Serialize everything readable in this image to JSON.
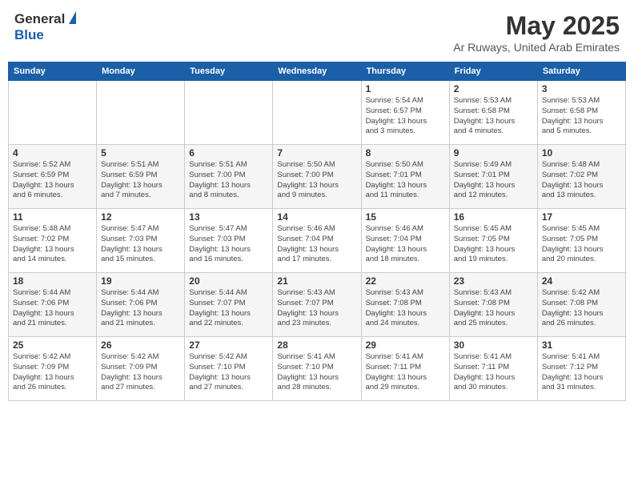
{
  "header": {
    "logo_general": "General",
    "logo_blue": "Blue",
    "title": "May 2025",
    "subtitle": "Ar Ruways, United Arab Emirates"
  },
  "weekdays": [
    "Sunday",
    "Monday",
    "Tuesday",
    "Wednesday",
    "Thursday",
    "Friday",
    "Saturday"
  ],
  "weeks": [
    [
      {
        "day": "",
        "info": ""
      },
      {
        "day": "",
        "info": ""
      },
      {
        "day": "",
        "info": ""
      },
      {
        "day": "",
        "info": ""
      },
      {
        "day": "1",
        "info": "Sunrise: 5:54 AM\nSunset: 6:57 PM\nDaylight: 13 hours\nand 3 minutes."
      },
      {
        "day": "2",
        "info": "Sunrise: 5:53 AM\nSunset: 6:58 PM\nDaylight: 13 hours\nand 4 minutes."
      },
      {
        "day": "3",
        "info": "Sunrise: 5:53 AM\nSunset: 6:58 PM\nDaylight: 13 hours\nand 5 minutes."
      }
    ],
    [
      {
        "day": "4",
        "info": "Sunrise: 5:52 AM\nSunset: 6:59 PM\nDaylight: 13 hours\nand 6 minutes."
      },
      {
        "day": "5",
        "info": "Sunrise: 5:51 AM\nSunset: 6:59 PM\nDaylight: 13 hours\nand 7 minutes."
      },
      {
        "day": "6",
        "info": "Sunrise: 5:51 AM\nSunset: 7:00 PM\nDaylight: 13 hours\nand 8 minutes."
      },
      {
        "day": "7",
        "info": "Sunrise: 5:50 AM\nSunset: 7:00 PM\nDaylight: 13 hours\nand 9 minutes."
      },
      {
        "day": "8",
        "info": "Sunrise: 5:50 AM\nSunset: 7:01 PM\nDaylight: 13 hours\nand 11 minutes."
      },
      {
        "day": "9",
        "info": "Sunrise: 5:49 AM\nSunset: 7:01 PM\nDaylight: 13 hours\nand 12 minutes."
      },
      {
        "day": "10",
        "info": "Sunrise: 5:48 AM\nSunset: 7:02 PM\nDaylight: 13 hours\nand 13 minutes."
      }
    ],
    [
      {
        "day": "11",
        "info": "Sunrise: 5:48 AM\nSunset: 7:02 PM\nDaylight: 13 hours\nand 14 minutes."
      },
      {
        "day": "12",
        "info": "Sunrise: 5:47 AM\nSunset: 7:03 PM\nDaylight: 13 hours\nand 15 minutes."
      },
      {
        "day": "13",
        "info": "Sunrise: 5:47 AM\nSunset: 7:03 PM\nDaylight: 13 hours\nand 16 minutes."
      },
      {
        "day": "14",
        "info": "Sunrise: 5:46 AM\nSunset: 7:04 PM\nDaylight: 13 hours\nand 17 minutes."
      },
      {
        "day": "15",
        "info": "Sunrise: 5:46 AM\nSunset: 7:04 PM\nDaylight: 13 hours\nand 18 minutes."
      },
      {
        "day": "16",
        "info": "Sunrise: 5:45 AM\nSunset: 7:05 PM\nDaylight: 13 hours\nand 19 minutes."
      },
      {
        "day": "17",
        "info": "Sunrise: 5:45 AM\nSunset: 7:05 PM\nDaylight: 13 hours\nand 20 minutes."
      }
    ],
    [
      {
        "day": "18",
        "info": "Sunrise: 5:44 AM\nSunset: 7:06 PM\nDaylight: 13 hours\nand 21 minutes."
      },
      {
        "day": "19",
        "info": "Sunrise: 5:44 AM\nSunset: 7:06 PM\nDaylight: 13 hours\nand 21 minutes."
      },
      {
        "day": "20",
        "info": "Sunrise: 5:44 AM\nSunset: 7:07 PM\nDaylight: 13 hours\nand 22 minutes."
      },
      {
        "day": "21",
        "info": "Sunrise: 5:43 AM\nSunset: 7:07 PM\nDaylight: 13 hours\nand 23 minutes."
      },
      {
        "day": "22",
        "info": "Sunrise: 5:43 AM\nSunset: 7:08 PM\nDaylight: 13 hours\nand 24 minutes."
      },
      {
        "day": "23",
        "info": "Sunrise: 5:43 AM\nSunset: 7:08 PM\nDaylight: 13 hours\nand 25 minutes."
      },
      {
        "day": "24",
        "info": "Sunrise: 5:42 AM\nSunset: 7:08 PM\nDaylight: 13 hours\nand 26 minutes."
      }
    ],
    [
      {
        "day": "25",
        "info": "Sunrise: 5:42 AM\nSunset: 7:09 PM\nDaylight: 13 hours\nand 26 minutes."
      },
      {
        "day": "26",
        "info": "Sunrise: 5:42 AM\nSunset: 7:09 PM\nDaylight: 13 hours\nand 27 minutes."
      },
      {
        "day": "27",
        "info": "Sunrise: 5:42 AM\nSunset: 7:10 PM\nDaylight: 13 hours\nand 27 minutes."
      },
      {
        "day": "28",
        "info": "Sunrise: 5:41 AM\nSunset: 7:10 PM\nDaylight: 13 hours\nand 28 minutes."
      },
      {
        "day": "29",
        "info": "Sunrise: 5:41 AM\nSunset: 7:11 PM\nDaylight: 13 hours\nand 29 minutes."
      },
      {
        "day": "30",
        "info": "Sunrise: 5:41 AM\nSunset: 7:11 PM\nDaylight: 13 hours\nand 30 minutes."
      },
      {
        "day": "31",
        "info": "Sunrise: 5:41 AM\nSunset: 7:12 PM\nDaylight: 13 hours\nand 31 minutes."
      }
    ]
  ]
}
